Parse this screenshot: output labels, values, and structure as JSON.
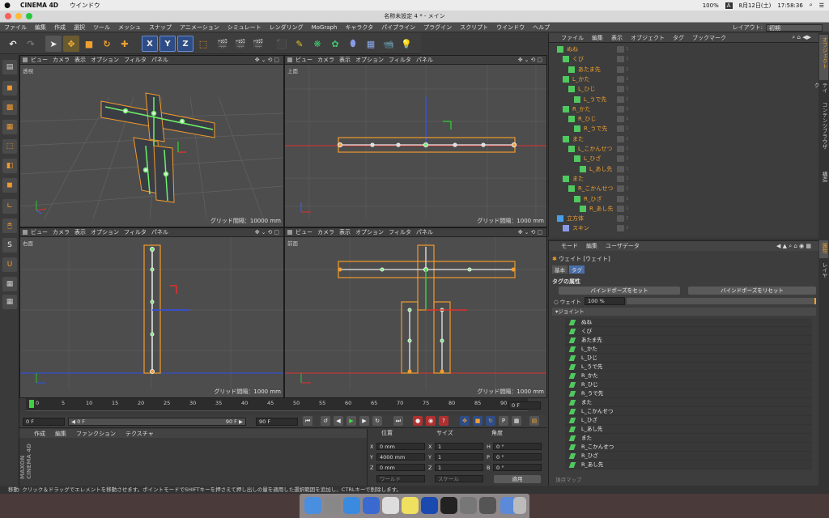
{
  "mac_menu": {
    "app": "CINEMA 4D",
    "window": "ウインドウ",
    "battery": "100%",
    "date": "8月12日(土)",
    "time": "17:58:36",
    "input": "A"
  },
  "window": {
    "title": "名称未設定 4 * - メイン"
  },
  "main_menu": [
    "ファイル",
    "編集",
    "作成",
    "選択",
    "ツール",
    "メッシュ",
    "スナップ",
    "アニメーション",
    "シミュレート",
    "レンダリング",
    "MoGraph",
    "キャラクタ",
    "パイプライン",
    "プラグイン",
    "スクリプト",
    "ウインドウ",
    "ヘルプ"
  ],
  "layout": {
    "label": "レイアウト:",
    "value": "初期"
  },
  "toolbar": {
    "x": "X",
    "y": "Y",
    "z": "Z"
  },
  "viewports": [
    {
      "menu": [
        "ビュー",
        "カメラ",
        "表示",
        "オプション",
        "フィルタ",
        "パネル"
      ],
      "label": "透視",
      "grid": "グリッド間隔：10000 mm"
    },
    {
      "menu": [
        "ビュー",
        "カメラ",
        "表示",
        "オプション",
        "フィルタ",
        "パネル"
      ],
      "label": "上面",
      "grid": "グリッド間隔：1000 mm"
    },
    {
      "menu": [
        "ビュー",
        "カメラ",
        "表示",
        "オプション",
        "フィルタ",
        "パネル"
      ],
      "label": "右面",
      "grid": "グリッド間隔：1000 mm"
    },
    {
      "menu": [
        "ビュー",
        "カメラ",
        "表示",
        "オプション",
        "フィルタ",
        "パネル"
      ],
      "label": "前面",
      "grid": "グリッド間隔：1000 mm"
    }
  ],
  "timeline": {
    "ticks": [
      "0",
      "5",
      "10",
      "15",
      "20",
      "25",
      "30",
      "35",
      "40",
      "45",
      "50",
      "55",
      "60",
      "65",
      "70",
      "75",
      "80",
      "85",
      "90"
    ],
    "end_label": "0 F"
  },
  "playback": {
    "current": "0 F",
    "start": "◀ 0 F",
    "end": "90 F ▶",
    "max": "90 F"
  },
  "material_manager": {
    "menu": [
      "作成",
      "編集",
      "ファンクション",
      "テクスチャ"
    ],
    "brand": "MAXON CINEMA 4D"
  },
  "coordinates": {
    "headers": [
      "位置",
      "サイズ",
      "角度"
    ],
    "rows": [
      {
        "axis": "X",
        "pos": "0 mm",
        "saxis": "X",
        "size": "1",
        "raxis": "H",
        "rot": "0 °"
      },
      {
        "axis": "Y",
        "pos": "4000 mm",
        "saxis": "Y",
        "size": "1",
        "raxis": "P",
        "rot": "0 °"
      },
      {
        "axis": "Z",
        "pos": "0 mm",
        "saxis": "Z",
        "size": "1",
        "raxis": "B",
        "rot": "0 °"
      }
    ],
    "mode1": "ワールド",
    "mode2": "スケール",
    "apply": "適用"
  },
  "status": "移動: クリック＆ドラッグでエレメントを移動させます。ポイントモードでSHIFTキーを押さえて押し出しの量を適用した選択範囲を追加し、CTRLキーで削除します。",
  "object_manager": {
    "menu": [
      "ファイル",
      "編集",
      "表示",
      "オブジェクト",
      "タグ",
      "ブックマーク"
    ],
    "objects": [
      {
        "name": "ぬね",
        "depth": 0
      },
      {
        "name": "くび",
        "depth": 1
      },
      {
        "name": "あたま先",
        "depth": 2
      },
      {
        "name": "L_かた",
        "depth": 1
      },
      {
        "name": "L_ひじ",
        "depth": 2
      },
      {
        "name": "L_うで先",
        "depth": 3
      },
      {
        "name": "R_かた",
        "depth": 1
      },
      {
        "name": "R_ひじ",
        "depth": 2
      },
      {
        "name": "R_うで先",
        "depth": 3
      },
      {
        "name": "また",
        "depth": 1
      },
      {
        "name": "L_こかんせつ",
        "depth": 2
      },
      {
        "name": "L_ひざ",
        "depth": 3
      },
      {
        "name": "L_あし先",
        "depth": 4
      },
      {
        "name": "また",
        "depth": 1
      },
      {
        "name": "R_こかんせつ",
        "depth": 2
      },
      {
        "name": "R_ひざ",
        "depth": 3
      },
      {
        "name": "R_あし先",
        "depth": 4
      },
      {
        "name": "立方体",
        "depth": 0
      },
      {
        "name": "スキン",
        "depth": 1
      }
    ]
  },
  "side_tabs": [
    "オブジェクト",
    "テイク",
    "コンテンツブラウザ",
    "構造",
    "属性",
    "レイヤー"
  ],
  "attribute_manager": {
    "menu": [
      "モード",
      "編集",
      "ユーザデータ"
    ],
    "title": "ウェイト [ウェイト]",
    "tabs": [
      "基本",
      "タグ"
    ],
    "section": "タグの属性",
    "bind_btn": "バインドポーズをセット",
    "reset_btn": "バインドポーズをリセット",
    "weight_label": "ウェイト",
    "weight_value": "100 %",
    "joint_section": "ジョイント",
    "joints": [
      "ぬね",
      "くび",
      "あたま先",
      "L_かた",
      "L_ひじ",
      "L_うで先",
      "R_かた",
      "R_ひじ",
      "R_うで先",
      "また",
      "L_こかんせつ",
      "L_ひざ",
      "L_あし先",
      "また",
      "R_こかんせつ",
      "R_ひざ",
      "R_あし先"
    ],
    "footer": "頂点マップ"
  }
}
